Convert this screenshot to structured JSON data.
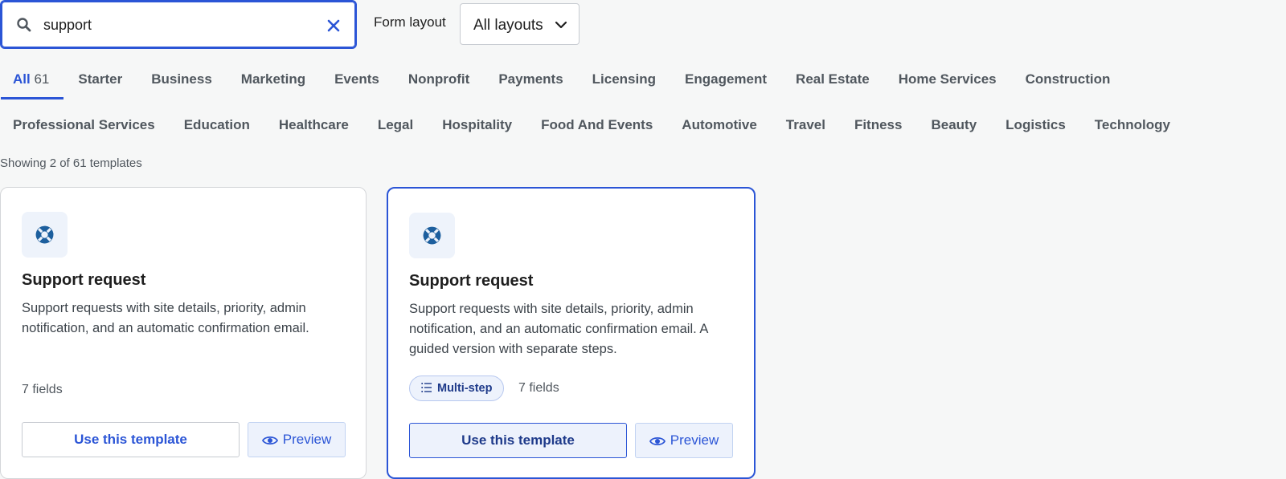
{
  "search": {
    "value": "support",
    "placeholder": "Search templates"
  },
  "layout": {
    "label": "Form layout",
    "selected": "All layouts"
  },
  "tabs_row1": [
    {
      "label": "All",
      "count": "61",
      "active": true
    },
    {
      "label": "Starter"
    },
    {
      "label": "Business"
    },
    {
      "label": "Marketing"
    },
    {
      "label": "Events"
    },
    {
      "label": "Nonprofit"
    },
    {
      "label": "Payments"
    },
    {
      "label": "Licensing"
    },
    {
      "label": "Engagement"
    },
    {
      "label": "Real Estate"
    },
    {
      "label": "Home Services"
    },
    {
      "label": "Construction"
    }
  ],
  "tabs_row2": [
    {
      "label": "Professional Services"
    },
    {
      "label": "Education"
    },
    {
      "label": "Healthcare"
    },
    {
      "label": "Legal"
    },
    {
      "label": "Hospitality"
    },
    {
      "label": "Food And Events"
    },
    {
      "label": "Automotive"
    },
    {
      "label": "Travel"
    },
    {
      "label": "Fitness"
    },
    {
      "label": "Beauty"
    },
    {
      "label": "Logistics"
    },
    {
      "label": "Technology"
    }
  ],
  "showing": "Showing 2 of 61 templates",
  "cards": [
    {
      "icon": "lifebuoy-icon",
      "title": "Support request",
      "desc": "Support requests with site details, priority, admin notification, and an automatic confirmation email.",
      "fields": "7 fields",
      "use_label": "Use this template",
      "preview_label": "Preview"
    },
    {
      "icon": "lifebuoy-icon",
      "title": "Support request",
      "desc": "Support requests with site details, priority, admin notification, and an automatic confirmation email. A guided version with separate steps.",
      "badge": "Multi-step",
      "fields": "7 fields",
      "use_label": "Use this template",
      "preview_label": "Preview"
    }
  ],
  "colors": {
    "accent": "#2b55d6",
    "badge_bg": "#edf2fc",
    "icon_tile": "#eef3fb"
  }
}
